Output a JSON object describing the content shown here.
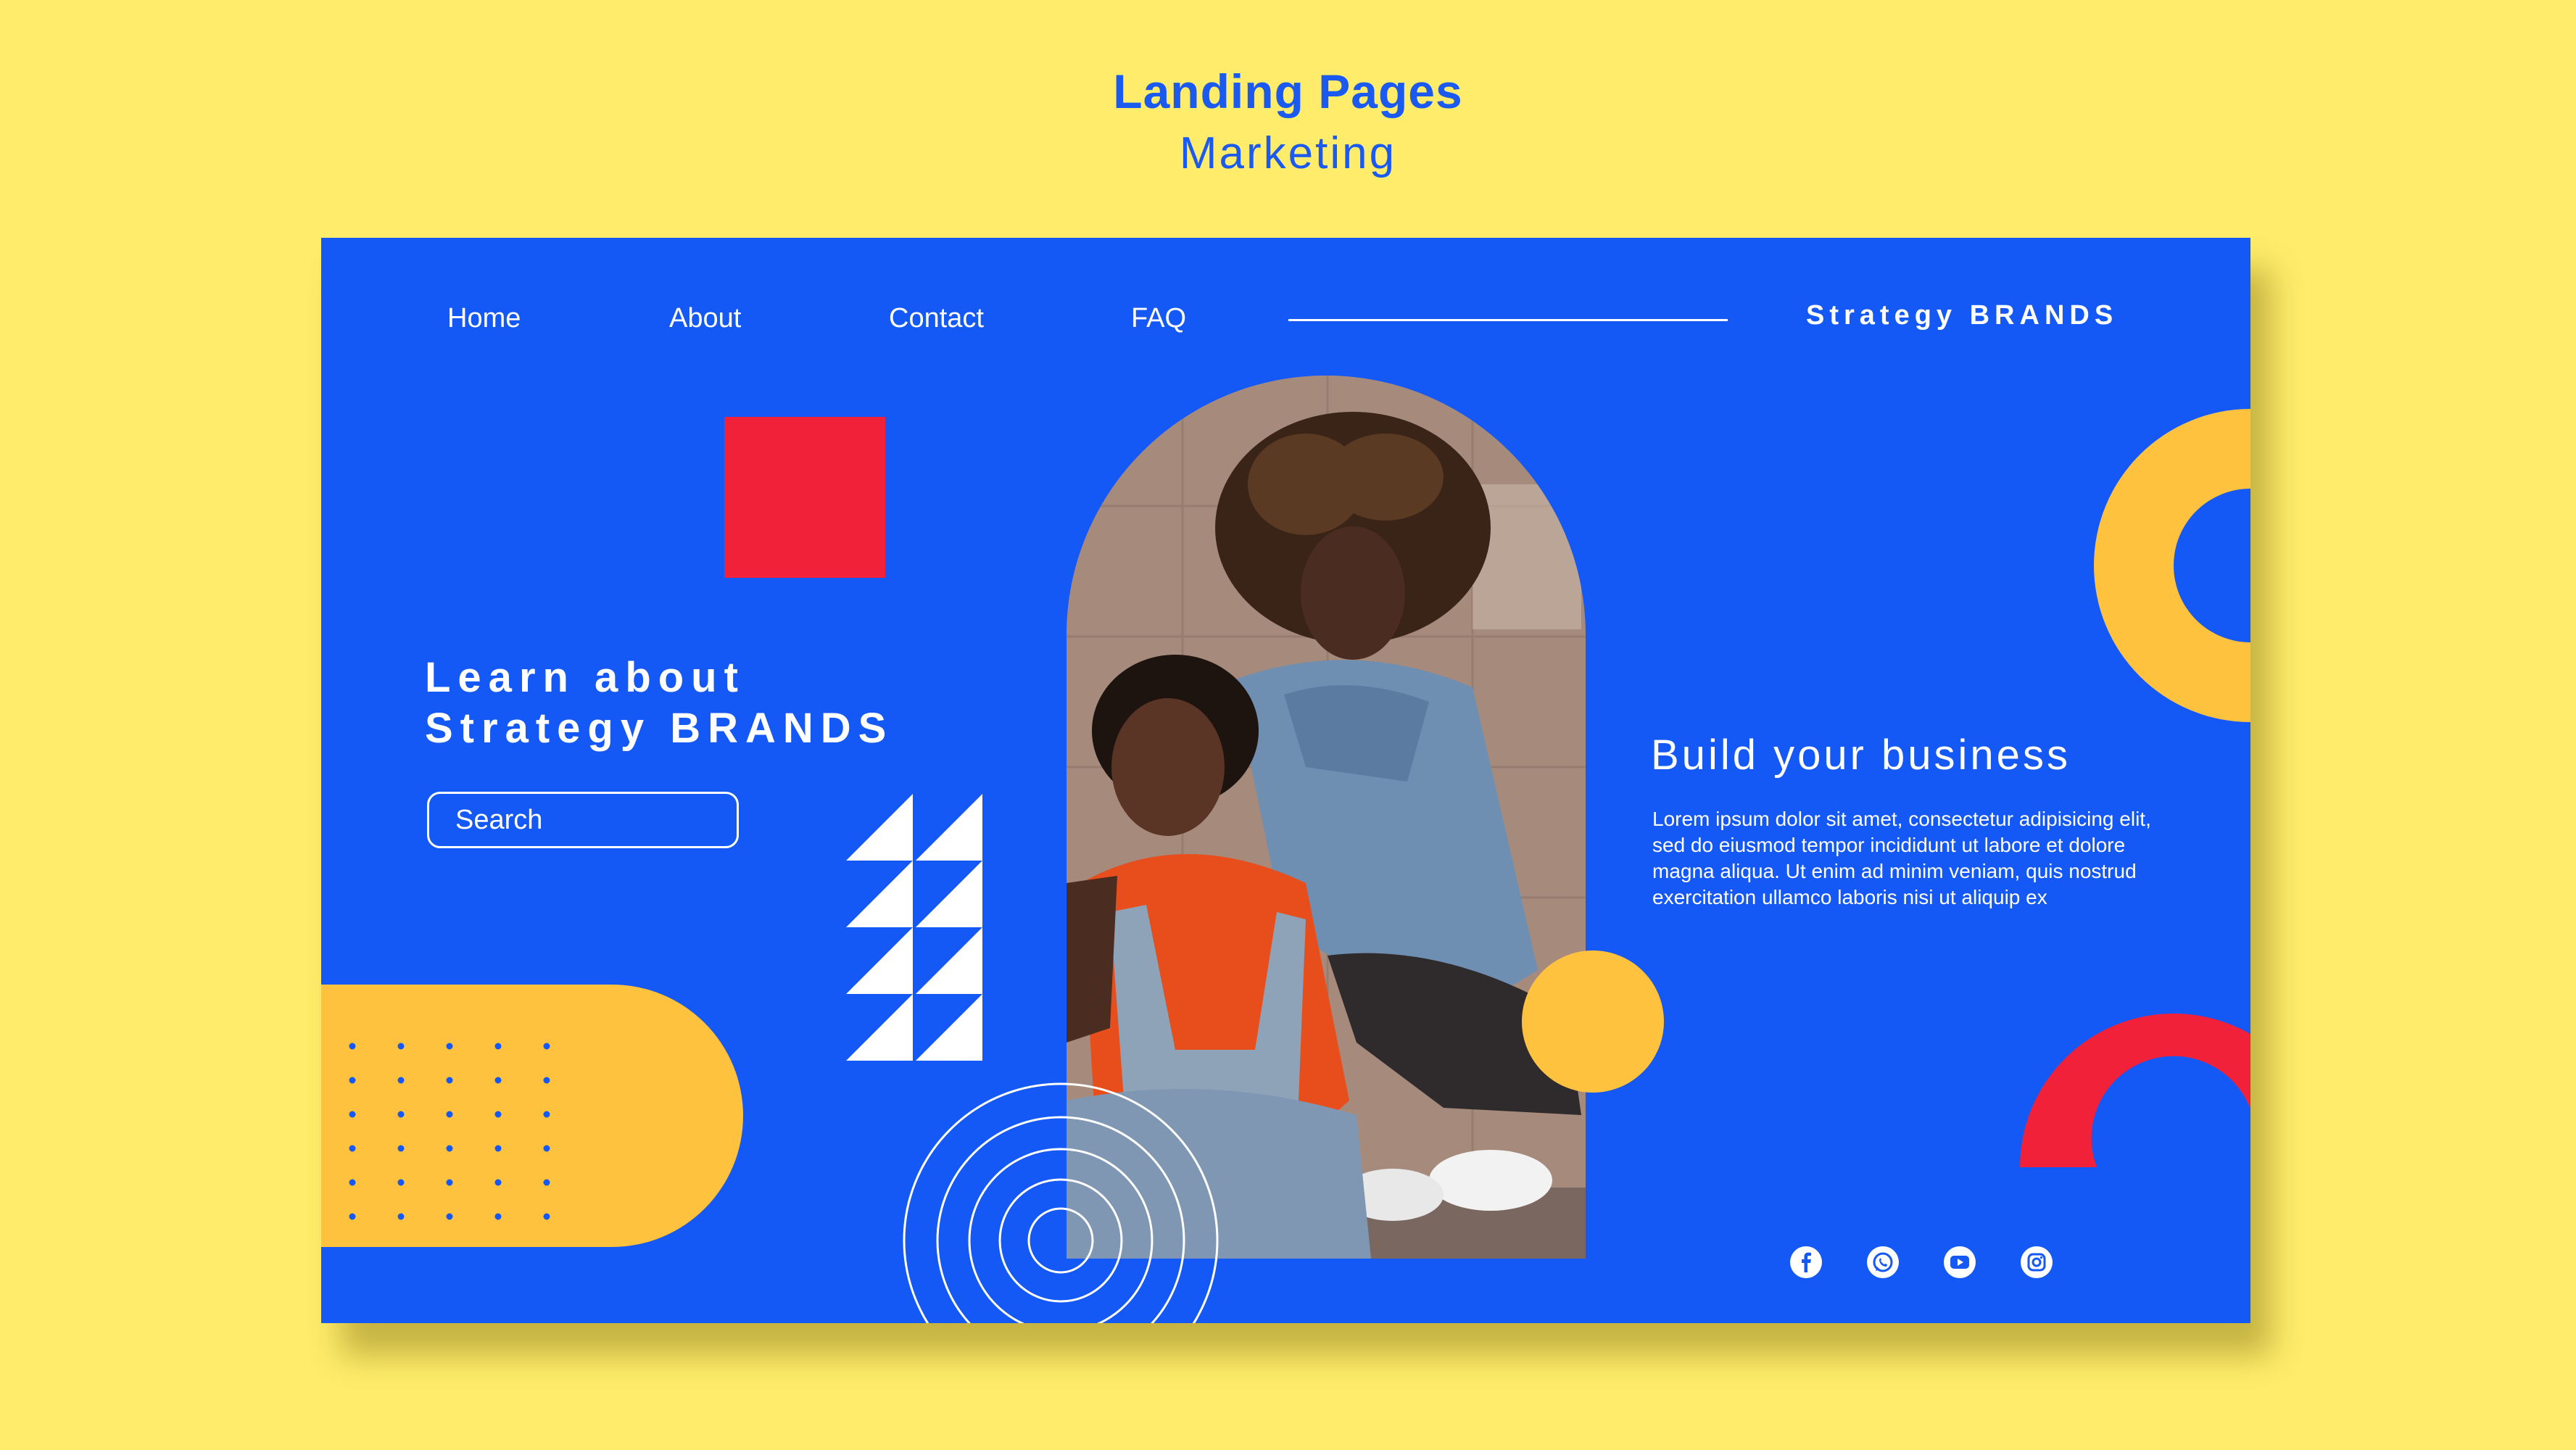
{
  "header": {
    "title": "Landing Pages",
    "subtitle": "Marketing"
  },
  "nav": {
    "items": [
      "Home",
      "About",
      "Contact",
      "FAQ"
    ],
    "brand": "Strategy BRANDS"
  },
  "hero": {
    "heading_line1": "Learn about",
    "heading_line2": "Strategy BRANDS",
    "search_placeholder": "Search"
  },
  "business": {
    "heading": "Build your business",
    "body": "Lorem ipsum dolor sit amet, consectetur adipisicing elit, sed do eiusmod tempor incididunt ut labore et dolore magna aliqua. Ut enim ad minim veniam, quis nostrud exercitation ullamco laboris nisi ut aliquip ex"
  },
  "social": [
    "facebook-icon",
    "whatsapp-icon",
    "youtube-icon",
    "instagram-icon"
  ],
  "colors": {
    "page_bg": "#FEEC6A",
    "card_bg": "#1458F5",
    "accent_red": "#F2213A",
    "accent_yellow": "#FFC23E",
    "text_blue": "#1A5AF0"
  }
}
